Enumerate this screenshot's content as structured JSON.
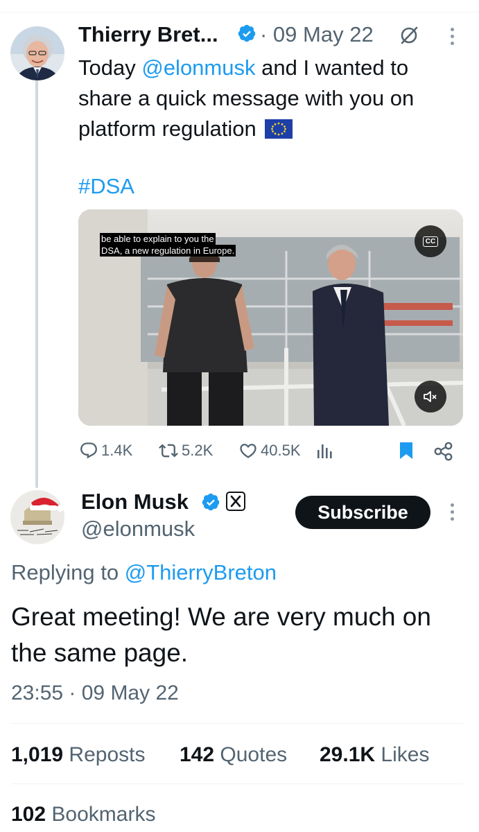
{
  "parent_tweet": {
    "author_name": "Thierry Bret...",
    "timestamp": "· 09 May 22",
    "text_prefix": "Today ",
    "mention": "@elonmusk",
    "text_suffix": " and I wanted to share a quick message with you on platform regulation",
    "flag_emoji": "eu-flag-icon",
    "hashtag": "#DSA",
    "video": {
      "caption_line1": "be able to explain to you the",
      "caption_line2": "DSA, a new regulation in Europe.",
      "cc_label": "CC"
    },
    "actions": {
      "replies": "1.4K",
      "reposts": "5.2K",
      "likes": "40.5K"
    }
  },
  "reply_tweet": {
    "author_name": "Elon Musk",
    "handle": "@elonmusk",
    "subscribe_label": "Subscribe",
    "replying_label": "Replying to ",
    "replying_to": "@ThierryBreton",
    "text": "Great meeting! We are very much on the same page.",
    "timestamp": "23:55 · 09 May 22",
    "stats": {
      "reposts_count": "1,019",
      "reposts_label": "Reposts",
      "quotes_count": "142",
      "quotes_label": "Quotes",
      "likes_count": "29.1K",
      "likes_label": "Likes",
      "bookmarks_count": "102",
      "bookmarks_label": "Bookmarks"
    }
  },
  "colors": {
    "accent": "#1d9bf0",
    "text": "#0f1419",
    "secondary": "#536471",
    "bookmark_active": "#1d9bf0"
  }
}
